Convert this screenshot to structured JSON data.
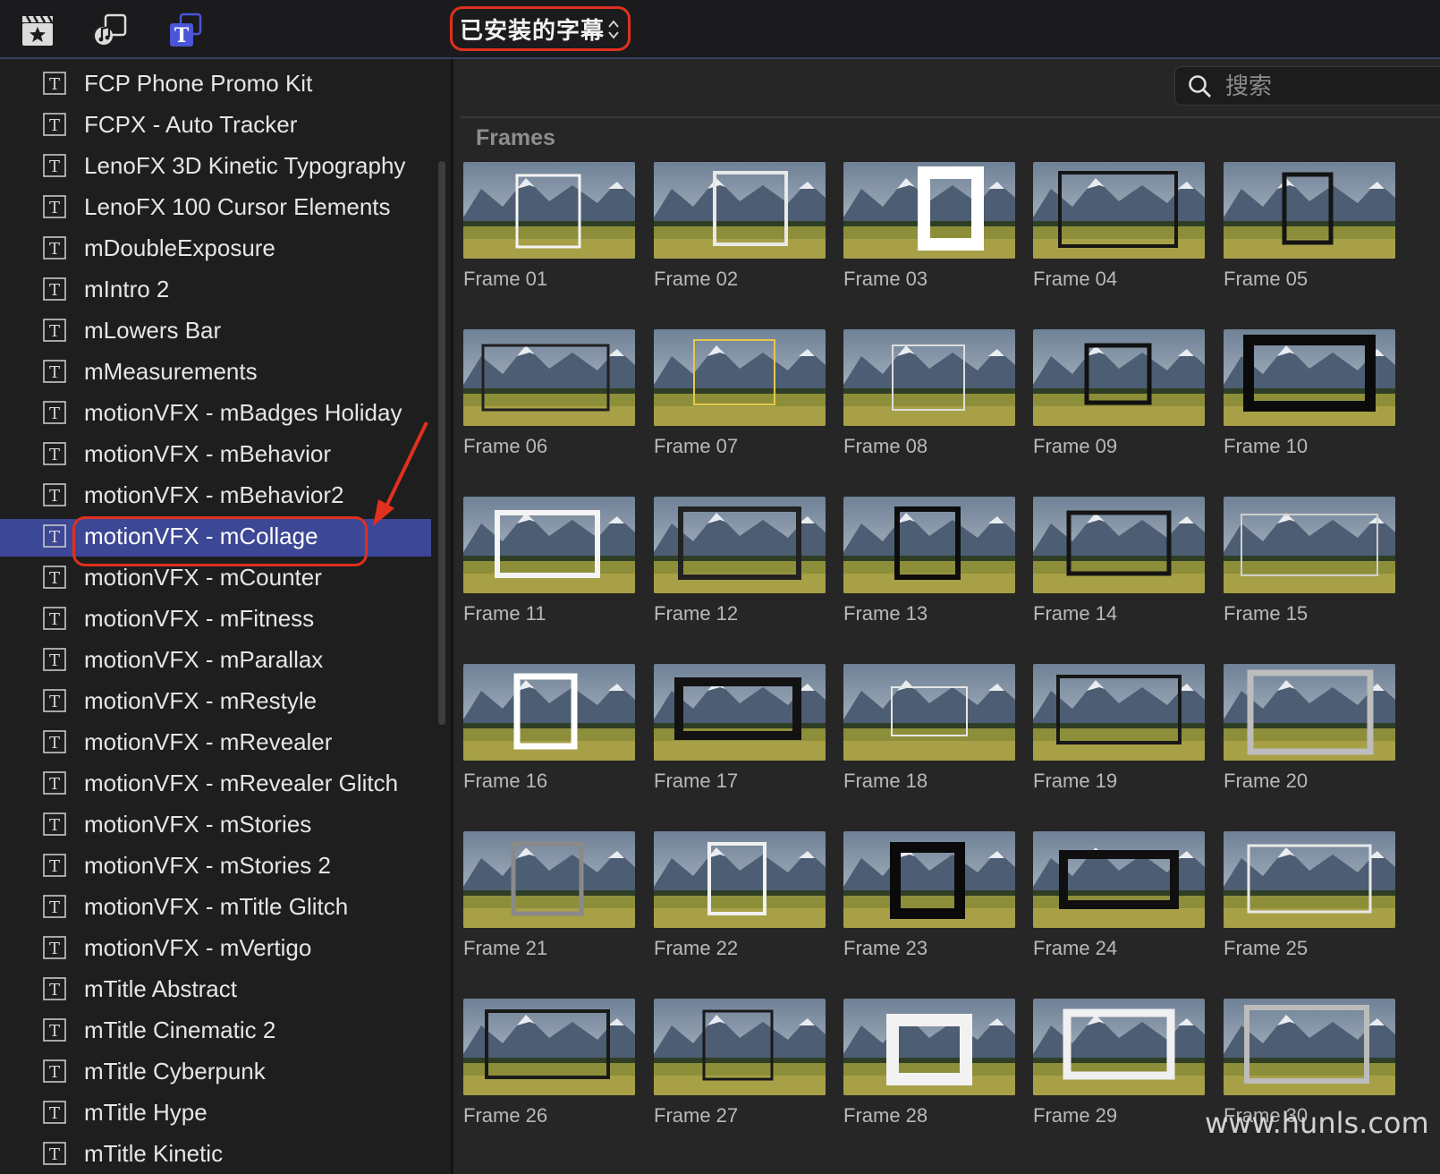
{
  "toolbar": {
    "icons": [
      "clapper-star-icon",
      "music-photo-icon",
      "titles-icon"
    ],
    "collection_label": "已安装的字幕"
  },
  "sidebar": {
    "selected_index": 11,
    "items": [
      "FCP Phone Promo Kit",
      "FCPX - Auto Tracker",
      "LenoFX 3D Kinetic Typography",
      "LenoFX 100 Cursor Elements",
      "mDoubleExposure",
      "mIntro 2",
      "mLowers Bar",
      "mMeasurements",
      "motionVFX - mBadges Holiday",
      "motionVFX - mBehavior",
      "motionVFX - mBehavior2",
      "motionVFX - mCollage",
      "motionVFX - mCounter",
      "motionVFX - mFitness",
      "motionVFX - mParallax",
      "motionVFX - mRestyle",
      "motionVFX - mRevealer",
      "motionVFX - mRevealer Glitch",
      "motionVFX - mStories",
      "motionVFX - mStories 2",
      "motionVFX - mTitle Glitch",
      "motionVFX - mVertigo",
      "mTitle Abstract",
      "mTitle Cinematic 2",
      "mTitle Cyberpunk",
      "mTitle Hype",
      "mTitle Kinetic"
    ]
  },
  "browser": {
    "search_placeholder": "搜索",
    "section_title": "Frames",
    "tiles": [
      "Frame 01",
      "Frame 02",
      "Frame 03",
      "Frame 04",
      "Frame 05",
      "Frame 06",
      "Frame 07",
      "Frame 08",
      "Frame 09",
      "Frame 10",
      "Frame 11",
      "Frame 12",
      "Frame 13",
      "Frame 14",
      "Frame 15",
      "Frame 16",
      "Frame 17",
      "Frame 18",
      "Frame 19",
      "Frame 20",
      "Frame 21",
      "Frame 22",
      "Frame 23",
      "Frame 24",
      "Frame 25",
      "Frame 26",
      "Frame 27",
      "Frame 28",
      "Frame 29",
      "Frame 30"
    ]
  },
  "watermark": "www.hunls.com",
  "colors": {
    "selection": "#3c4796",
    "annotation_red": "#e0301e",
    "accent_blue": "#4a55d8"
  }
}
